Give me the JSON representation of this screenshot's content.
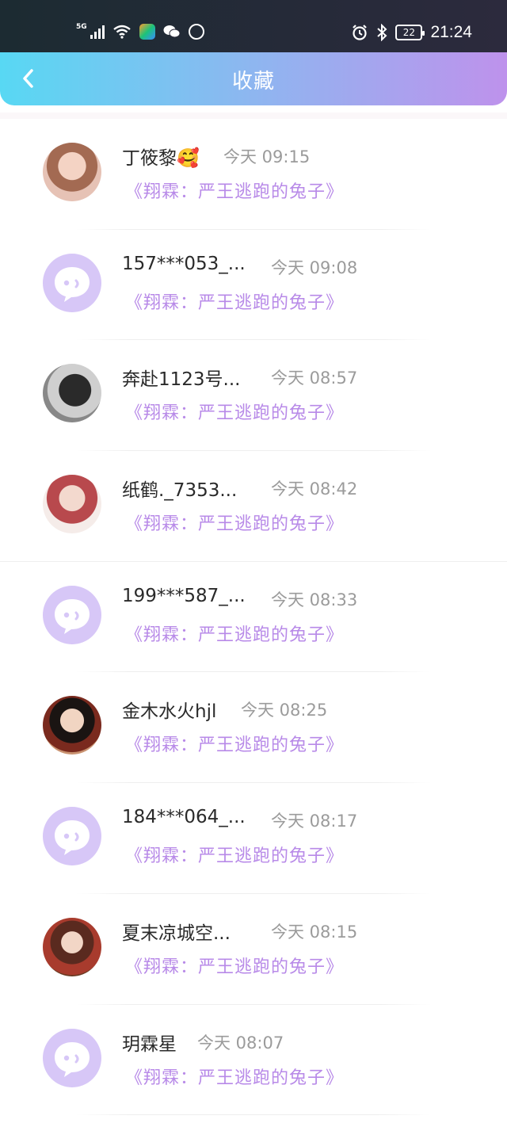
{
  "status_bar": {
    "network": "5G",
    "time": "21:24",
    "battery": "22"
  },
  "header": {
    "title": "收藏"
  },
  "items": [
    {
      "name": "丁筱黎🥰",
      "time": "今天 09:15",
      "work": "《翔霖：严王逃跑的兔子》",
      "avatar": "photo1"
    },
    {
      "name": "157***053_...",
      "time": "今天 09:08",
      "work": "《翔霖：严王逃跑的兔子》",
      "avatar": "default"
    },
    {
      "name": "奔赴1123号...",
      "time": "今天 08:57",
      "work": "《翔霖：严王逃跑的兔子》",
      "avatar": "photo2"
    },
    {
      "name": "纸鹤._7353...",
      "time": "今天 08:42",
      "work": "《翔霖：严王逃跑的兔子》",
      "avatar": "photo3"
    },
    {
      "name": "199***587_...",
      "time": "今天 08:33",
      "work": "《翔霖：严王逃跑的兔子》",
      "avatar": "default"
    },
    {
      "name": "金木水火hjl",
      "time": "今天 08:25",
      "work": "《翔霖：严王逃跑的兔子》",
      "avatar": "photo4"
    },
    {
      "name": "184***064_...",
      "time": "今天 08:17",
      "work": "《翔霖：严王逃跑的兔子》",
      "avatar": "default"
    },
    {
      "name": "夏末凉城空...",
      "time": "今天 08:15",
      "work": "《翔霖：严王逃跑的兔子》",
      "avatar": "photo5"
    },
    {
      "name": "玥霖星",
      "time": "今天 08:07",
      "work": "《翔霖：严王逃跑的兔子》",
      "avatar": "default"
    }
  ],
  "colors": {
    "header_start": "#58d8f3",
    "header_end": "#be92ec",
    "work_title": "#b88ae8",
    "default_avatar": "#d7c7f7"
  }
}
